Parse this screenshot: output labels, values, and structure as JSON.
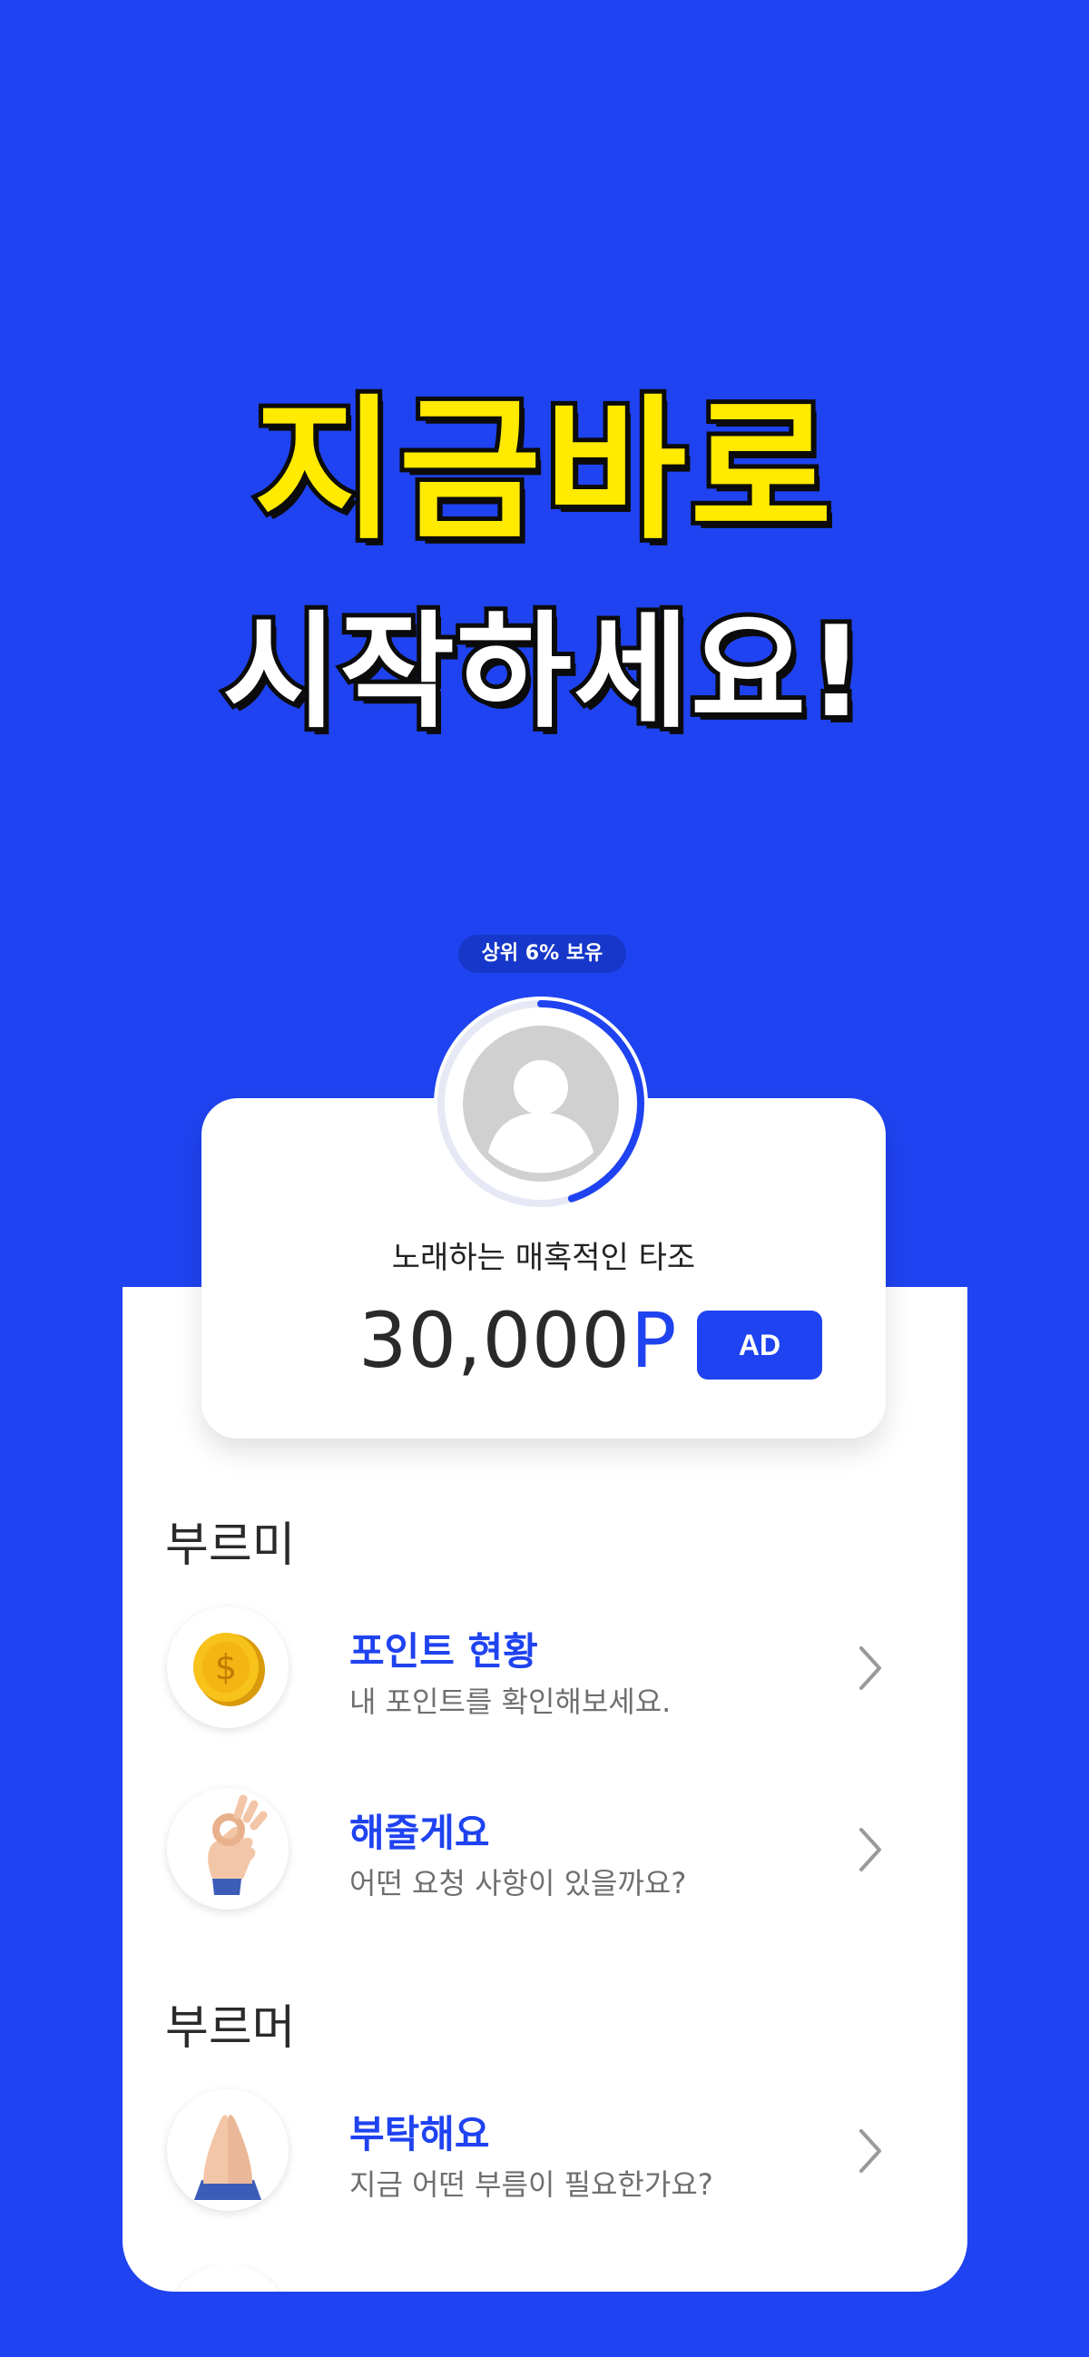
{
  "promo": {
    "headline_line1": "지금바로",
    "headline_line2": "시작하세요!"
  },
  "profile": {
    "rank_badge": "상위 6% 보유",
    "nickname": "노래하는 매혹적인 타조",
    "points_value": "30,000",
    "points_unit": "P",
    "ad_button_label": "AD",
    "progress_fraction": 0.45
  },
  "sections": [
    {
      "title": "부르미",
      "items": [
        {
          "icon": "coin-icon",
          "title": "포인트 현황",
          "desc": "내 포인트를 확인해보세요."
        },
        {
          "icon": "ok-hand-icon",
          "title": "해줄게요",
          "desc": "어떤 요청 사항이 있을까요?"
        }
      ]
    },
    {
      "title": "부르머",
      "items": [
        {
          "icon": "praying-hands-icon",
          "title": "부탁해요",
          "desc": "지금 어떤 부름이 필요한가요?"
        }
      ]
    }
  ],
  "colors": {
    "brand_blue": "#1f43f0",
    "headline_yellow": "#ffea00"
  }
}
